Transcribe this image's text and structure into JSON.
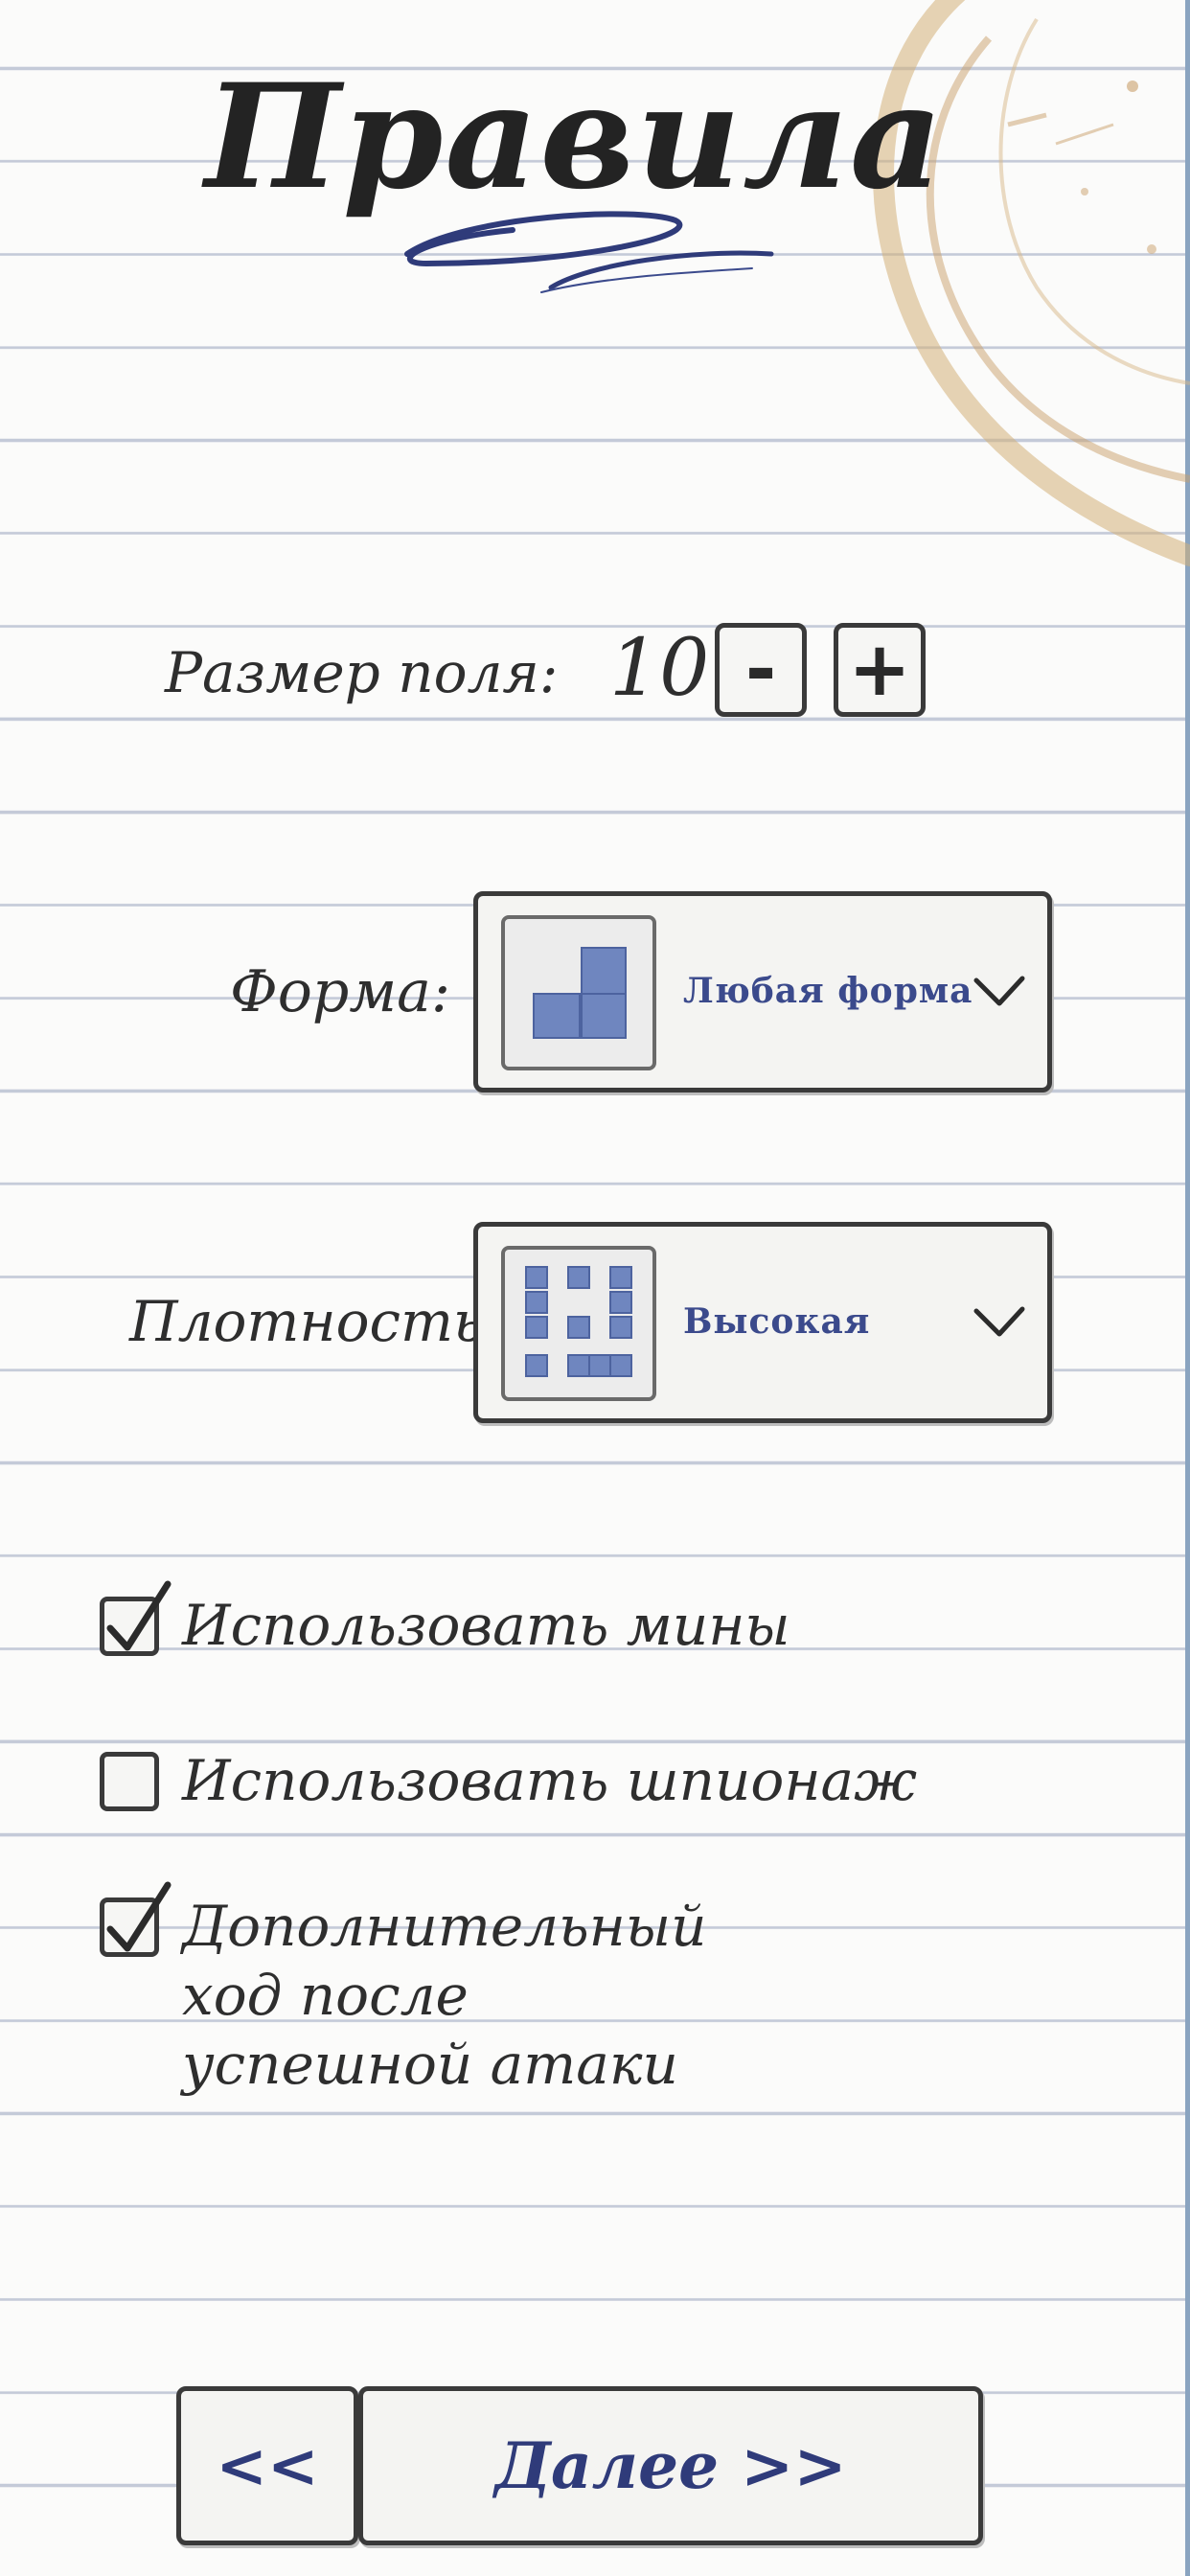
{
  "header": {
    "title": "Правила"
  },
  "field_size": {
    "label": "Размер поля:",
    "value": "10",
    "decrement_label": "-",
    "increment_label": "+"
  },
  "shape": {
    "label": "Форма:",
    "selected": "Любая форма",
    "icon": "L-shape-thumbnail-icon"
  },
  "density": {
    "label": "Плотность:",
    "selected": "Высокая",
    "icon": "density-grid-thumbnail-icon"
  },
  "options": [
    {
      "label": "Использовать мины",
      "checked": true
    },
    {
      "label": "Использовать шпионаж",
      "checked": false
    },
    {
      "label": "Дополнительный ход после\nуспешной атаки",
      "checked": true
    }
  ],
  "footer": {
    "back_label": "<<",
    "next_label": "Далее >>"
  },
  "colors": {
    "ink": "#2b2b2b",
    "accent_blue": "#3b4a8c",
    "paper_line": "#c4cad8",
    "coffee": "#c9a06a"
  }
}
